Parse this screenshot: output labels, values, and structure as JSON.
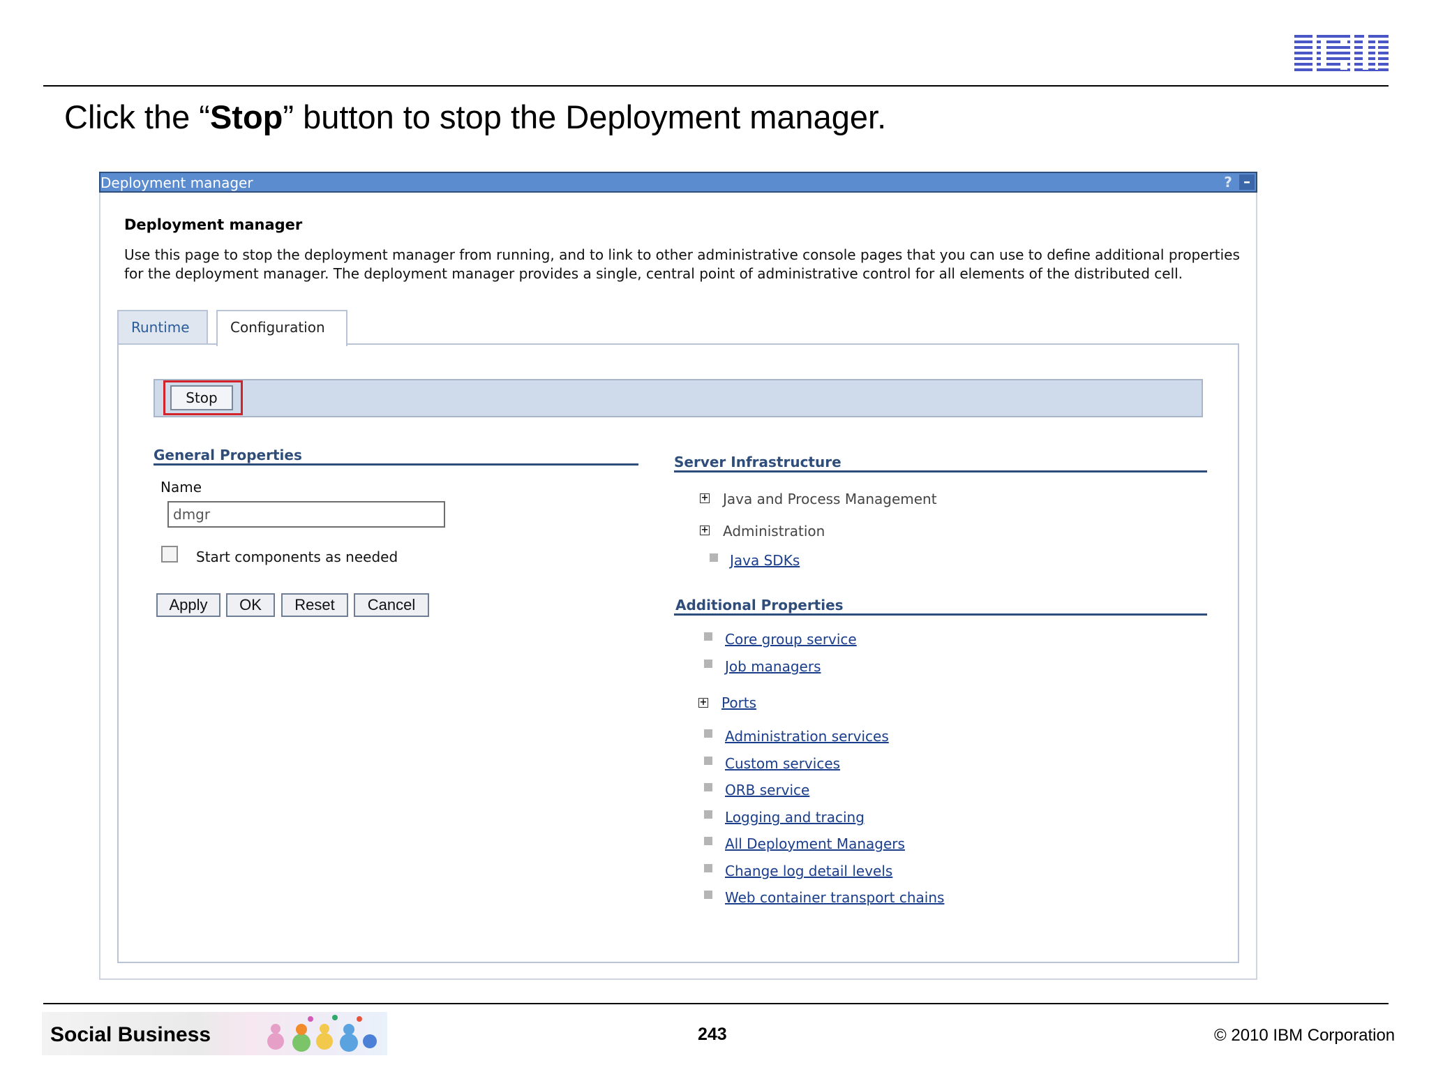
{
  "slide": {
    "logo_text": "IBM",
    "instruction_prefix": "Click the “",
    "instruction_bold": "Stop",
    "instruction_suffix": "” button to stop the Deployment manager."
  },
  "panel": {
    "title": "Deployment manager",
    "help_label": "?",
    "minimize_label": "–",
    "heading": "Deployment manager",
    "description": "Use this page to stop the deployment manager from running, and to link to other administrative console pages that you can use to define additional properties for the deployment manager. The deployment manager provides a single, central point of administrative control for all elements of the distributed cell."
  },
  "tabs": [
    {
      "label": "Runtime",
      "active": false
    },
    {
      "label": "Configuration",
      "active": true
    }
  ],
  "actions": {
    "stop_label": "Stop",
    "highlight_color": "#d2232a"
  },
  "general_properties": {
    "heading": "General Properties",
    "name_label": "Name",
    "name_value": "dmgr",
    "checkbox_label": "Start components as needed",
    "checkbox_checked": false,
    "buttons": [
      "Apply",
      "OK",
      "Reset",
      "Cancel"
    ]
  },
  "server_infrastructure": {
    "heading": "Server Infrastructure",
    "items": [
      {
        "label": "Java and Process Management",
        "type": "expandable"
      },
      {
        "label": "Administration",
        "type": "expandable"
      },
      {
        "label": "Java SDKs",
        "type": "link"
      }
    ]
  },
  "additional_properties": {
    "heading": "Additional Properties",
    "items": [
      {
        "label": "Core group service",
        "type": "link"
      },
      {
        "label": "Job managers",
        "type": "link"
      },
      {
        "label": "Ports",
        "type": "expandable-link"
      },
      {
        "label": "Administration services",
        "type": "link"
      },
      {
        "label": "Custom services",
        "type": "link"
      },
      {
        "label": "ORB service",
        "type": "link"
      },
      {
        "label": "Logging and tracing",
        "type": "link"
      },
      {
        "label": "All Deployment Managers",
        "type": "link"
      },
      {
        "label": "Change log detail levels",
        "type": "link"
      },
      {
        "label": "Web container transport chains",
        "type": "link"
      }
    ]
  },
  "footer": {
    "brand": "Social Business",
    "page_number": "243",
    "copyright": "© 2010 IBM Corporation"
  },
  "colors": {
    "titlebar": "#5b8ccf",
    "section_heading": "#2f4d7a",
    "link": "#1a3e8c",
    "ibm_logo": "#4a56c8"
  }
}
